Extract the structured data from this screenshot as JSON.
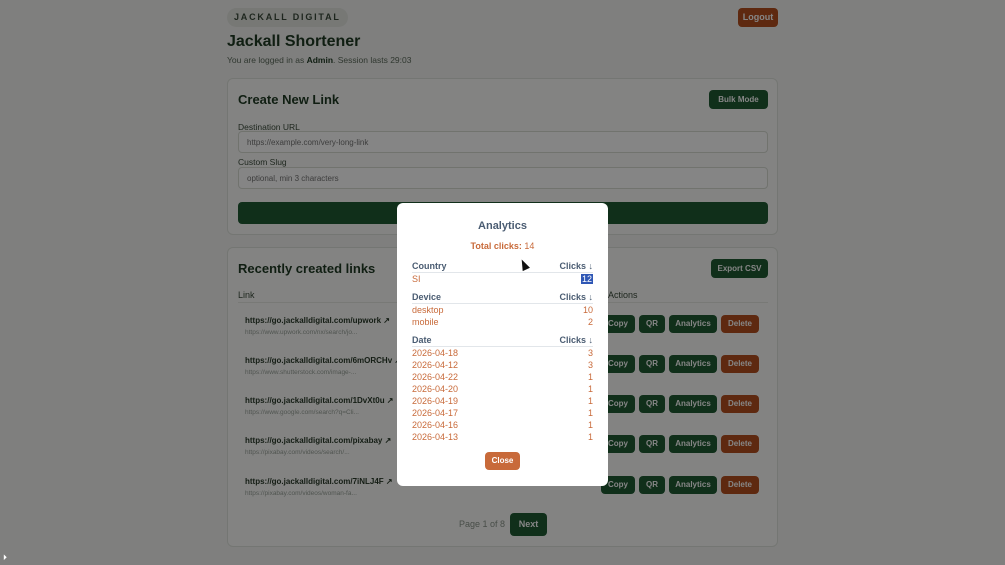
{
  "header": {
    "brand": "JACKALL DIGITAL",
    "title": "Jackall Shortener",
    "session_prefix": "You are logged in as",
    "user": "Admin",
    "session_suffix": ". Session lasts 29:03",
    "logout_label": "Logout"
  },
  "create": {
    "title": "Create New Link",
    "bulk_label": "Bulk Mode",
    "destination_label": "Destination URL",
    "destination_placeholder": "https://example.com/very-long-link",
    "slug_label": "Custom Slug",
    "slug_placeholder": "optional, min 3 characters"
  },
  "recent": {
    "title": "Recently created links",
    "export_label": "Export CSV",
    "col_link": "Link",
    "col_actions": "Actions",
    "actions": {
      "copy": "Copy",
      "qr": "QR",
      "analytics": "Analytics",
      "delete": "Delete"
    },
    "rows": [
      {
        "short": "https://go.jackalldigital.com/upwork ↗",
        "dest": "https://www.upwork.com/nx/search/jo..."
      },
      {
        "short": "https://go.jackalldigital.com/6mORCHv ↗",
        "dest": "https://www.shutterstock.com/image-..."
      },
      {
        "short": "https://go.jackalldigital.com/1DvXt0u ↗",
        "dest": "https://www.google.com/search?q=Cli..."
      },
      {
        "short": "https://go.jackalldigital.com/pixabay ↗",
        "dest": "https://pixabay.com/videos/search/..."
      },
      {
        "short": "https://go.jackalldigital.com/7iNLJ4F ↗",
        "dest": "https://pixabay.com/videos/woman-fa..."
      }
    ],
    "pager": {
      "text": "Page 1 of 8",
      "next_label": "Next"
    }
  },
  "modal": {
    "title": "Analytics",
    "total_label": "Total clicks:",
    "total_value": "14",
    "clicks_header": "Clicks ↓",
    "country": {
      "title": "Country",
      "rows": [
        {
          "key": "SI",
          "value": "12"
        }
      ]
    },
    "device": {
      "title": "Device",
      "rows": [
        {
          "key": "desktop",
          "value": "10"
        },
        {
          "key": "mobile",
          "value": "2"
        }
      ]
    },
    "date": {
      "title": "Date",
      "rows": [
        {
          "key": "2026-04-18",
          "value": "3"
        },
        {
          "key": "2026-04-12",
          "value": "3"
        },
        {
          "key": "2026-04-22",
          "value": "1"
        },
        {
          "key": "2026-04-20",
          "value": "1"
        },
        {
          "key": "2026-04-19",
          "value": "1"
        },
        {
          "key": "2026-04-17",
          "value": "1"
        },
        {
          "key": "2026-04-16",
          "value": "1"
        },
        {
          "key": "2026-04-13",
          "value": "1"
        }
      ]
    },
    "close_label": "Close"
  },
  "colors": {
    "primary": "#1f5a33",
    "danger": "#b5501f",
    "accent": "#c86a3a",
    "heading": "#4a5c72"
  }
}
